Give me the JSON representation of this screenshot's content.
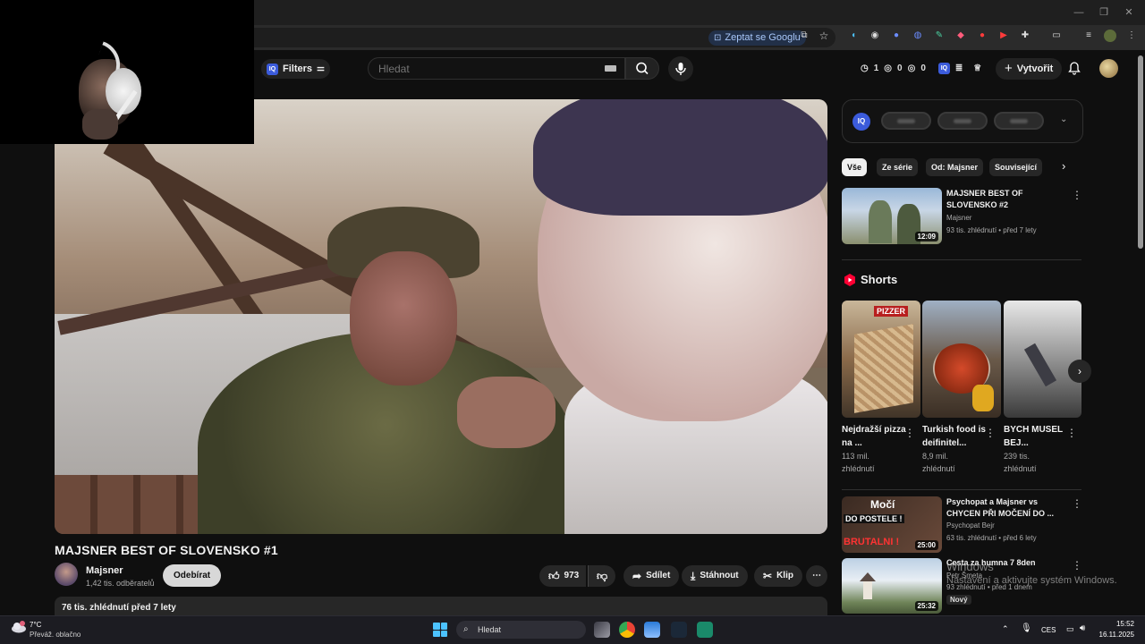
{
  "browser": {
    "ask_google_label": "Zeptat se Googlu"
  },
  "header": {
    "filters_label": "Filters",
    "search_placeholder": "Hledat",
    "stat_timer": "1",
    "stat_views": "0",
    "stat_eye": "0",
    "create_label": "Vytvořit"
  },
  "video": {
    "title": "MAJSNER BEST OF SLOVENSKO #1",
    "channel_name": "Majsner",
    "channel_subs": "1,42 tis. odběratelů",
    "subscribe_label": "Odebírat",
    "like_count": "973",
    "share_label": "Sdílet",
    "download_label": "Stáhnout",
    "clip_label": "Klip",
    "stats": "76 tis. zhlédnutí  před 7 lety"
  },
  "sidebar": {
    "chips": [
      "Vše",
      "Ze série",
      "Od: Majsner",
      "Související"
    ],
    "recommended": [
      {
        "title": "MAJSNER BEST OF SLOVENSKO #2",
        "channel": "Majsner",
        "meta": "93 tis. zhlédnutí • před 7 lety",
        "duration": "12:09"
      },
      {
        "title": "Psychopat a Majsner vs CHYCEN PŘI MOČENÍ DO ...",
        "channel": "Psychopat Bejr",
        "meta": "63 tis. zhlédnutí • před 6 lety",
        "duration": "25:00",
        "thumb_text1": "Močí",
        "thumb_text2": "DO POSTELE !",
        "thumb_text3": "BRUTALNI !"
      },
      {
        "title": "Cesta za humna 7 8den",
        "channel": "Petr Šmeta",
        "meta": "93 zhlédnutí • před 1 dnem",
        "duration": "25:32",
        "badge": "Nový"
      }
    ],
    "shorts_heading": "Shorts",
    "shorts": [
      {
        "title": "Nejdražší pizza na ...",
        "views": "113 mil.",
        "views_label": "zhlédnutí",
        "thumb_label": "PIZZER"
      },
      {
        "title": "Turkish food is deifinitel...",
        "views": "8,9 mil.",
        "views_label": "zhlédnutí"
      },
      {
        "title": "BYCH MUSEL BEJ...",
        "views": "239 tis.",
        "views_label": "zhlédnutí"
      }
    ]
  },
  "watermark": {
    "line1": "Windows",
    "line2": "Nastavení a aktivujte systém Windows."
  },
  "taskbar": {
    "weather_temp": "7°C",
    "weather_desc": "Převáž. oblačno",
    "search_label": "Hledat",
    "language": "CES",
    "time": "15:52",
    "date": "16.11.2025"
  },
  "colors": {
    "youtube_red": "#ff0033",
    "accent_blue": "#3ea6ff",
    "iq_blue": "#3b5bdb"
  }
}
